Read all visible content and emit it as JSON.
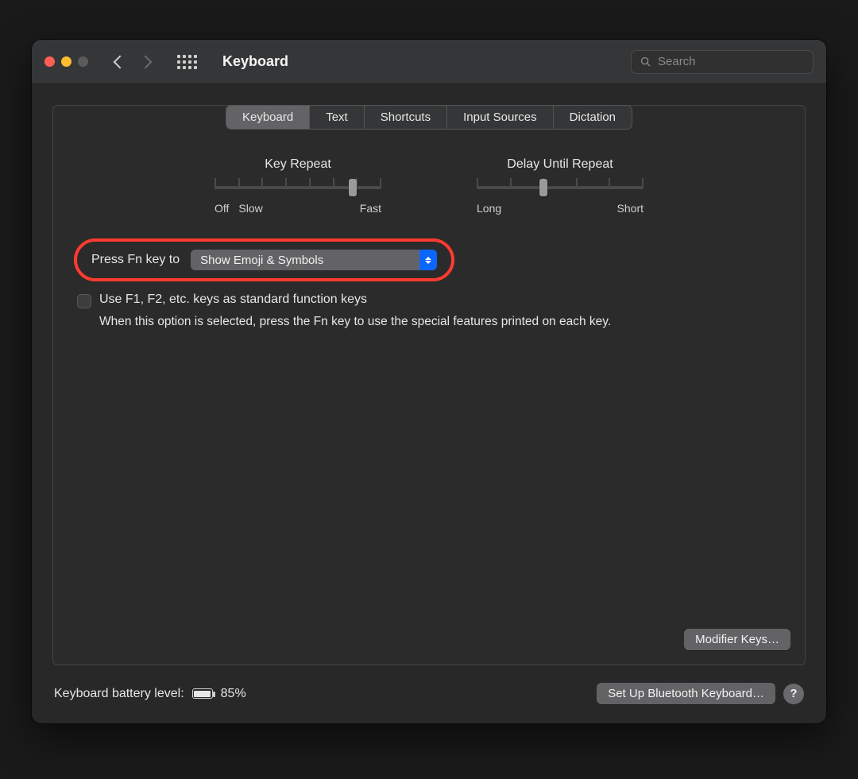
{
  "window": {
    "title": "Keyboard"
  },
  "search": {
    "placeholder": "Search"
  },
  "tabs": [
    "Keyboard",
    "Text",
    "Shortcuts",
    "Input Sources",
    "Dictation"
  ],
  "sliders": {
    "key_repeat": {
      "label": "Key Repeat",
      "left1": "Off",
      "left2": "Slow",
      "right": "Fast",
      "pos_pct": 83,
      "ticks": 8
    },
    "delay": {
      "label": "Delay Until Repeat",
      "left": "Long",
      "right": "Short",
      "pos_pct": 40,
      "ticks": 6
    }
  },
  "fn": {
    "label": "Press Fn key to",
    "value": "Show Emoji & Symbols"
  },
  "function_keys": {
    "checkbox_label": "Use F1, F2, etc. keys as standard function keys",
    "description": "When this option is selected, press the Fn key to use the special features printed on each key."
  },
  "buttons": {
    "modifier": "Modifier Keys…",
    "bluetooth": "Set Up Bluetooth Keyboard…"
  },
  "battery": {
    "label": "Keyboard battery level:",
    "percent_text": "85%",
    "percent": 85
  },
  "help_glyph": "?"
}
